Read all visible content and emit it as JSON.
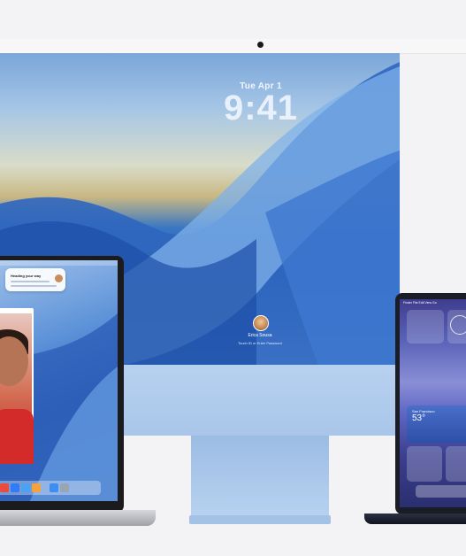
{
  "imac": {
    "date": "Tue Apr 1",
    "time": "9:41",
    "user_name": "Erica Sousa",
    "password_hint": "Touch ID or Enter Password"
  },
  "macbook_pro": {
    "notification_title": "Heading your way"
  },
  "macbook_air": {
    "menu_items": "Finder  File  Edit  View  Go",
    "weather_city": "San Francisco",
    "weather_temp": "53°"
  },
  "colors": {
    "imac_blue": "#a9c6ea",
    "mbp_space_black": "#1b1b1d",
    "mba_midnight": "#1a1d26"
  }
}
